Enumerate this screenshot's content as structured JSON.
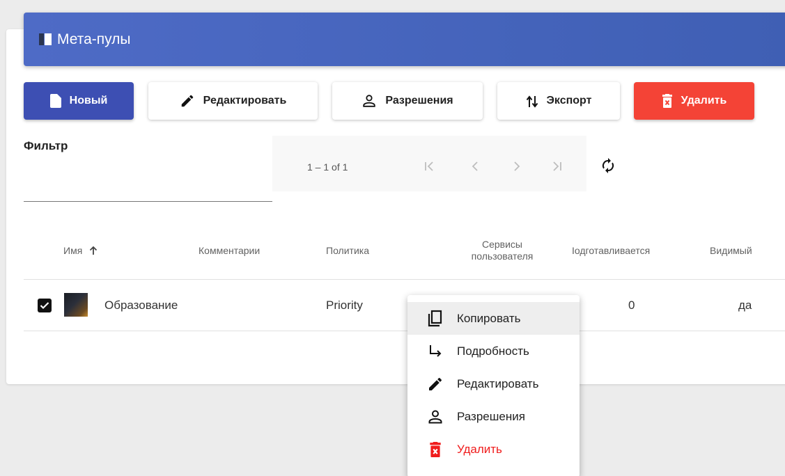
{
  "header": {
    "title": "Мета-пулы"
  },
  "toolbar": {
    "new_label": "Новый",
    "edit_label": "Редактировать",
    "permissions_label": "Разрешения",
    "export_label": "Экспорт",
    "delete_label": "Удалить"
  },
  "filter": {
    "label": "Фильтр",
    "value": ""
  },
  "pager": {
    "range": "1 – 1 of 1"
  },
  "table": {
    "columns": {
      "name": "Имя",
      "comments": "Комментарии",
      "policy": "Политика",
      "services": "Сервисы пользователя",
      "preparing": "Іодготавливается",
      "visible": "Видимый"
    },
    "rows": [
      {
        "name": "Образование",
        "comments": "",
        "policy": "Priority",
        "preparing": "0",
        "visible": "да",
        "checked": true
      }
    ]
  },
  "context_menu": {
    "items": [
      {
        "label": "Копировать",
        "icon": "copy-icon"
      },
      {
        "label": "Подробность",
        "icon": "subdirectory-arrow-icon"
      },
      {
        "label": "Редактировать",
        "icon": "pencil-icon"
      },
      {
        "label": "Разрешения",
        "icon": "person-icon"
      },
      {
        "label": "Удалить",
        "icon": "trash-icon"
      }
    ]
  },
  "colors": {
    "header": "#4e6bc6",
    "primary": "#3d4fb3",
    "danger": "#f44336",
    "danger_text": "#f01c1c"
  }
}
